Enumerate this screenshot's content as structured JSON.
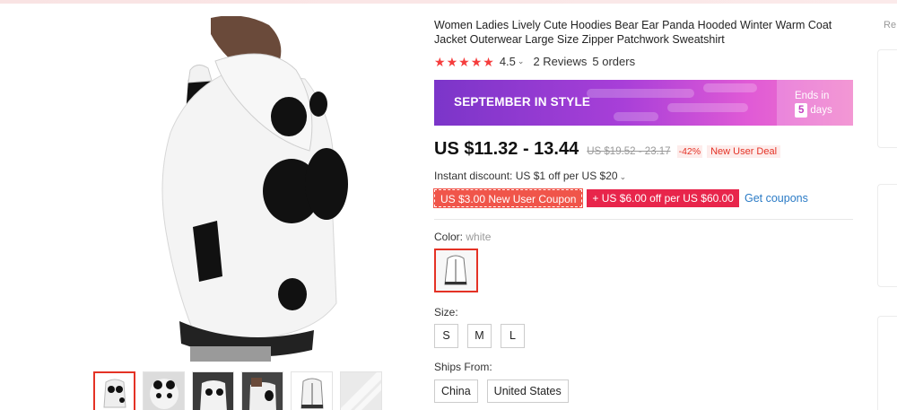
{
  "product": {
    "title": "Women Ladies Lively Cute Hoodies Bear Ear Panda Hooded Winter Warm Coat Jacket Outerwear Large Size Zipper Patchwork Sweatshirt",
    "rating": "4.5",
    "reviews": "2 Reviews",
    "orders": "5 orders"
  },
  "banner": {
    "label": "SEPTEMBER IN STYLE",
    "ends_in": "Ends in",
    "days_num": "5",
    "days_label": "days"
  },
  "price": {
    "current": "US $11.32 - 13.44",
    "original": "US $19.52 - 23.17",
    "discount": "-42%",
    "deal": "New User Deal"
  },
  "instant_discount": "Instant discount: US $1 off per US $20",
  "coupons": [
    "US $3.00 New User Coupon",
    "+ US $6.00 off per US $60.00"
  ],
  "get_coupons": "Get coupons",
  "color": {
    "label": "Color:",
    "value": "white"
  },
  "size": {
    "label": "Size:",
    "options": [
      "S",
      "M",
      "L"
    ]
  },
  "ships": {
    "label": "Ships From:",
    "options": [
      "China",
      "United States"
    ]
  },
  "right_panel": {
    "label": "Re"
  },
  "colors": {
    "accent": "#e43225",
    "link": "#2b7bc6",
    "banner_start": "#7b35c9",
    "banner_end": "#f07bc8"
  }
}
